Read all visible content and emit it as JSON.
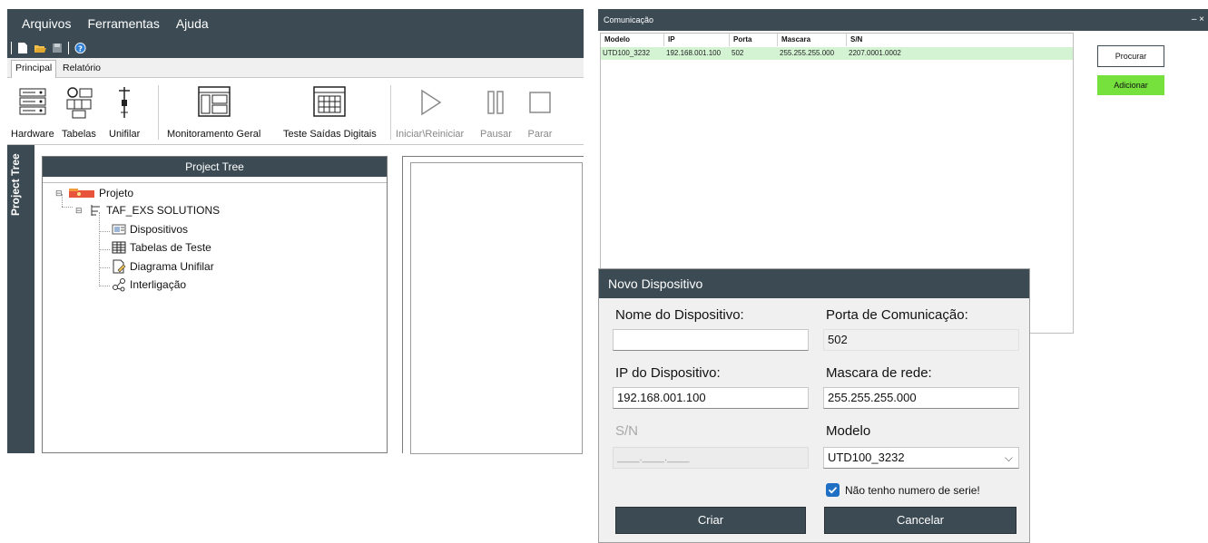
{
  "left_app": {
    "menu": [
      "Arquivos",
      "Ferramentas",
      "Ajuda"
    ],
    "ribbon_tabs": [
      "Principal",
      "Relatório"
    ],
    "ribbon_buttons": {
      "hardware": "Hardware",
      "tabelas": "Tabelas",
      "unifilar": "Unifilar",
      "monitoramento": "Monitoramento Geral",
      "teste_saidas": "Teste Saídas Digitais",
      "iniciar": "Iniciar\\Reiniciar",
      "pausar": "Pausar",
      "parar": "Parar"
    },
    "sidebar_label": "Project Tree",
    "project_tree_header": "Project Tree",
    "tree": {
      "root": "Projeto",
      "solution": "TAF_EXS SOLUTIONS",
      "children": [
        "Dispositivos",
        "Tabelas de Teste",
        "Diagrama Unifilar",
        "Interligação"
      ]
    },
    "colors": {
      "chrome": "#3b4a53"
    }
  },
  "comunicacao": {
    "title": "Comunicação",
    "window_controls": "– ×",
    "columns": [
      "Modelo",
      "IP",
      "Porta",
      "Mascara",
      "S/N"
    ],
    "rows": [
      {
        "modelo": "UTD100_3232",
        "ip": "192.168.001.100",
        "porta": "502",
        "mascara": "255.255.255.000",
        "sn": "2207.0001.0002"
      }
    ],
    "buttons": {
      "procurar": "Procurar",
      "adicionar": "Adicionar"
    },
    "colors": {
      "selected_row": "#d3f3d3",
      "adicionar_bg": "#76e13d"
    }
  },
  "novo_dispositivo": {
    "title": "Novo Dispositivo",
    "labels": {
      "nome": "Nome do Dispositivo:",
      "porta": "Porta de Comunicação:",
      "ip": "IP do Dispositivo:",
      "mascara": "Mascara de rede:",
      "sn": "S/N",
      "modelo": "Modelo"
    },
    "values": {
      "nome": "",
      "porta": "502",
      "ip": "192.168.001.100",
      "mascara": "255.255.255.000",
      "sn": "____.____.____",
      "modelo": "UTD100_3232"
    },
    "checkbox_label": "Não tenho numero de serie!",
    "checkbox_checked": true,
    "buttons": {
      "criar": "Criar",
      "cancelar": "Cancelar"
    }
  }
}
